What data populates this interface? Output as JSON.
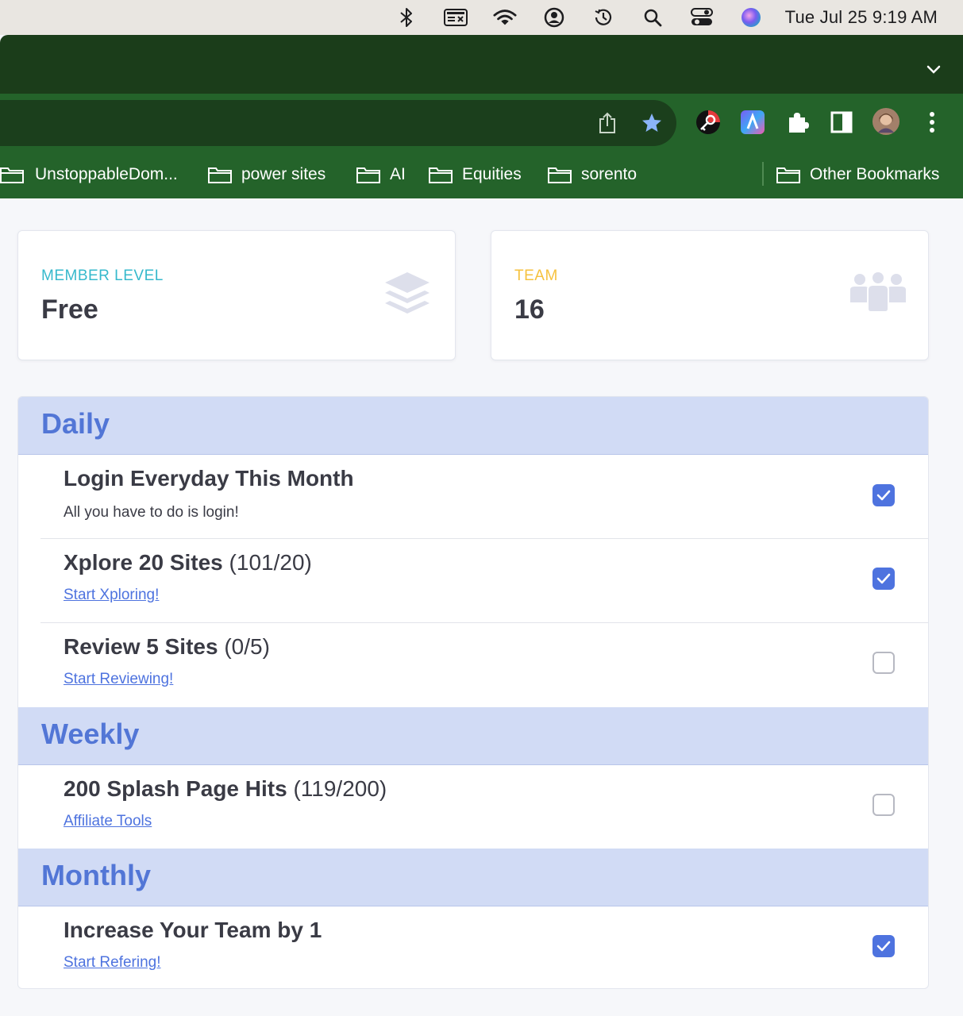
{
  "menubar": {
    "icons": [
      "bluetooth-icon",
      "keyboard-icon",
      "wifi-icon",
      "user-icon",
      "time-machine-icon",
      "spotlight-icon",
      "control-center-icon",
      "siri-icon"
    ],
    "clock": "Tue Jul 25  9:19 AM"
  },
  "toolbar": {
    "extensions": [
      "share-icon",
      "bookmark-star-icon",
      "password-extension-icon",
      "vpn-extension-icon",
      "extensions-puzzle-icon",
      "side-panel-icon",
      "profile-avatar",
      "menu-icon"
    ]
  },
  "bookmarks": {
    "items": [
      {
        "label": "UnstoppableDom..."
      },
      {
        "label": "power sites"
      },
      {
        "label": "AI"
      },
      {
        "label": "Equities"
      },
      {
        "label": "sorento"
      }
    ],
    "other": "Other Bookmarks"
  },
  "cards": {
    "member": {
      "label": "MEMBER LEVEL",
      "value": "Free",
      "color": "#36b9cc"
    },
    "team": {
      "label": "TEAM",
      "value": "16",
      "color": "#f6c23e"
    }
  },
  "sections": {
    "daily": {
      "title": "Daily",
      "tasks": [
        {
          "title": "Login Everyday This Month",
          "progress": "",
          "sub": "All you have to do is login!",
          "checked": true
        },
        {
          "title": "Xplore 20 Sites",
          "progress": "(101/20)",
          "link": "Start Xploring!",
          "checked": true
        },
        {
          "title": "Review 5 Sites",
          "progress": "(0/5)",
          "link": "Start Reviewing!",
          "checked": false
        }
      ]
    },
    "weekly": {
      "title": "Weekly",
      "tasks": [
        {
          "title": "200 Splash Page Hits",
          "progress": "(119/200)",
          "link": "Affiliate Tools",
          "checked": false
        }
      ]
    },
    "monthly": {
      "title": "Monthly",
      "tasks": [
        {
          "title": "Increase Your Team by 1",
          "progress": "",
          "link": "Start Refering!",
          "checked": true
        }
      ]
    }
  },
  "colors": {
    "accent": "#4e73df",
    "section_bg": "#d1dbf5",
    "browser_frame": "#1b3d1a",
    "browser_toolbar": "#24632a"
  }
}
